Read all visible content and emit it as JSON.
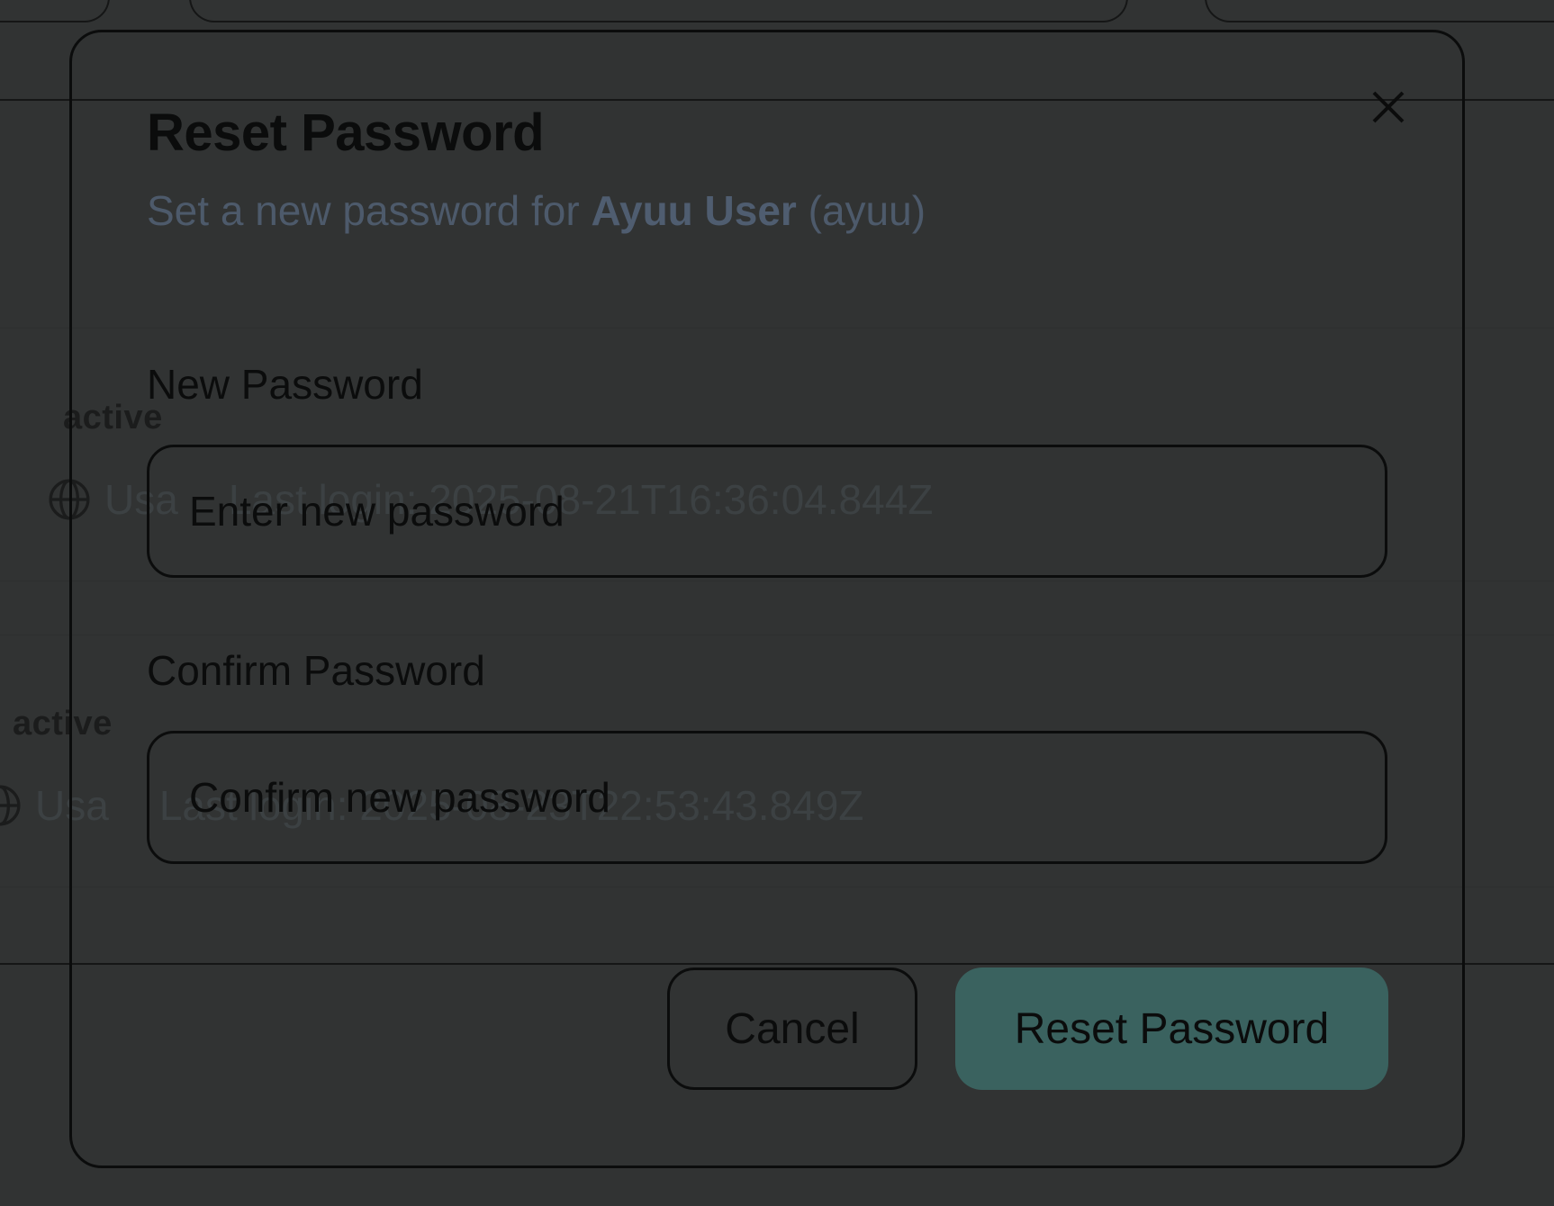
{
  "background": {
    "rows": [
      {
        "status": "active",
        "location": "Usa",
        "last_login": "Last login: 2025-08-21T16:36:04.844Z"
      },
      {
        "status": "active",
        "location": "Usa",
        "last_login": "Last login: 2025-08-23T22:53:43.849Z"
      }
    ]
  },
  "modal": {
    "title": "Reset Password",
    "description_prefix": "Set a new password for",
    "user_display_name": "Ayuu User",
    "username": "(ayuu)",
    "close_icon": "close-icon",
    "fields": {
      "new_password": {
        "label": "New Password",
        "placeholder": "Enter new password",
        "value": ""
      },
      "confirm_password": {
        "label": "Confirm Password",
        "placeholder": "Confirm new password",
        "value": ""
      }
    },
    "actions": {
      "cancel_label": "Cancel",
      "submit_label": "Reset Password"
    }
  },
  "colors": {
    "overlay": "#313333",
    "primary_button": "#3a625f",
    "text": "#0b0c0c",
    "muted_text": "#4d5a6b"
  }
}
